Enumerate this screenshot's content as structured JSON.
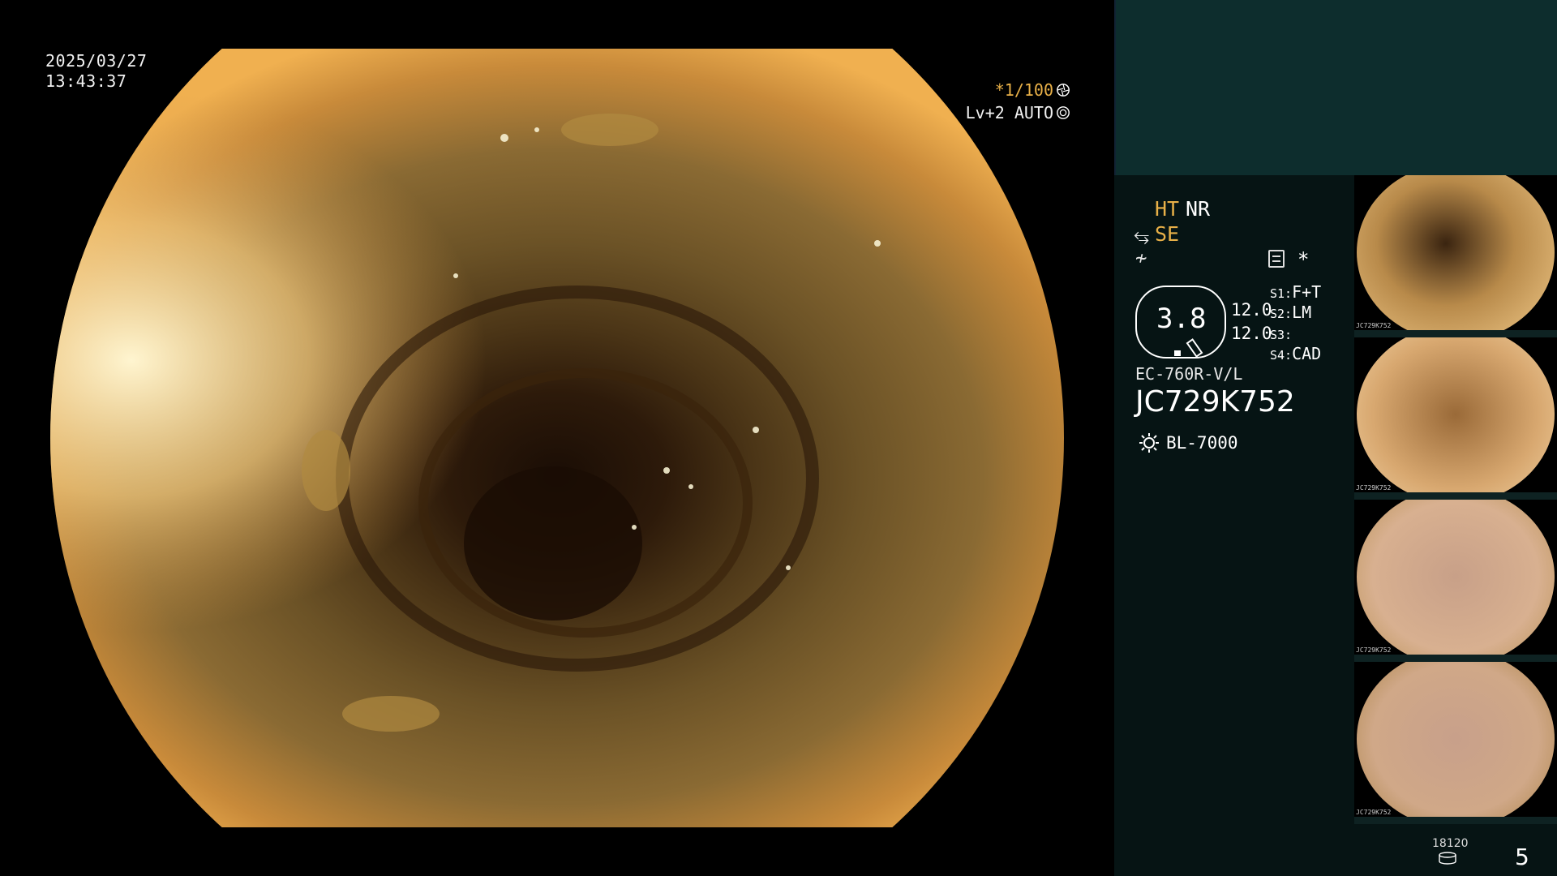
{
  "overlay": {
    "date": "2025/03/27",
    "time": "13:43:37",
    "shutter": "*1/100",
    "level": "Lv+2 AUTO"
  },
  "panel": {
    "ht": "HT",
    "nr": "NR",
    "se": "SE",
    "zoom_value": "3.8",
    "value_1": "12.0",
    "value_2": "12.0",
    "s1_key": "S1:",
    "s1_val": "F+T",
    "s2_key": "S2:",
    "s2_val": "LM",
    "s3_key": "S3:",
    "s3_val": "",
    "s4_key": "S4:",
    "s4_val": "CAD",
    "scope_model": "EC-760R-V/L",
    "scope_serial": "JC729K752",
    "light_source": "BL-7000",
    "storage_count": "18120",
    "page_number": "5"
  },
  "thumbnails": [
    {
      "label": "JC729K752"
    },
    {
      "label": "JC729K752"
    },
    {
      "label": "JC729K752"
    },
    {
      "label": "JC729K752"
    }
  ],
  "colors": {
    "accent": "#e8b048",
    "panel_bg": "#061414",
    "panel_top": "#0d2d2d"
  }
}
